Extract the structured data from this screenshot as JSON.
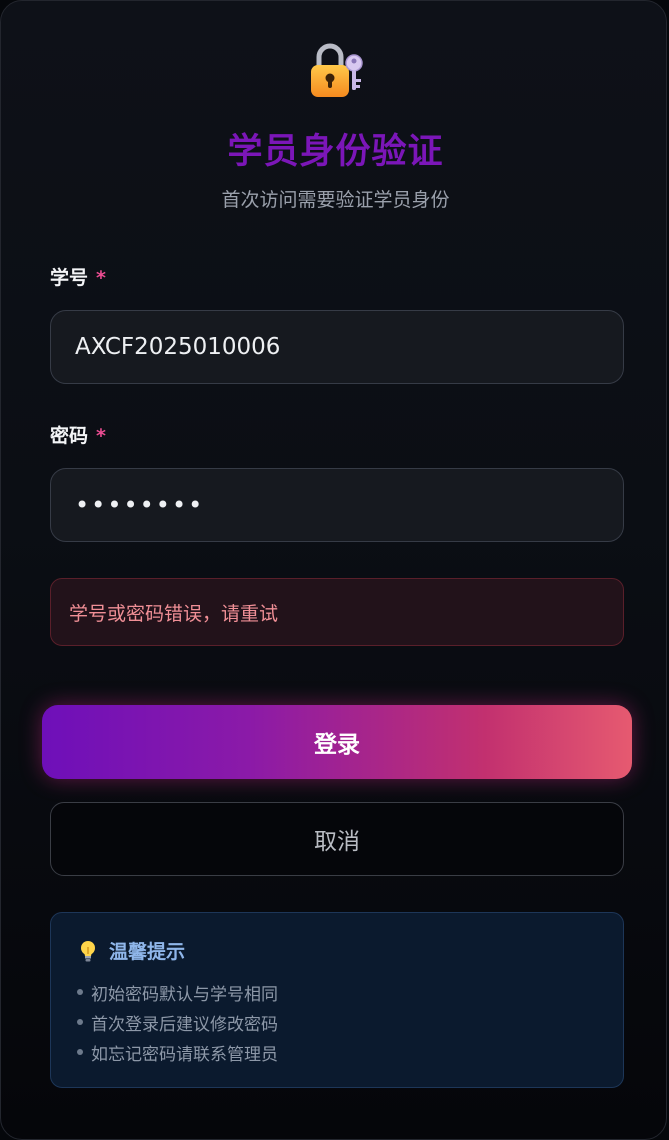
{
  "header": {
    "icon": "lock-with-key-icon",
    "title": "学员身份验证",
    "subtitle": "首次访问需要验证学员身份"
  },
  "form": {
    "student_id": {
      "label": "学号",
      "required_mark": "*",
      "value": "AXCF2025010006"
    },
    "password": {
      "label": "密码",
      "required_mark": "*",
      "value": "••••••••"
    },
    "error_message": "学号或密码错误，请重试"
  },
  "actions": {
    "login_label": "登录",
    "cancel_label": "取消"
  },
  "tips": {
    "icon": "lightbulb-icon",
    "title": "温馨提示",
    "items": [
      "初始密码默认与学号相同",
      "首次登录后建议修改密码",
      "如忘记密码请联系管理员"
    ]
  },
  "colors": {
    "title": "#7b16b8",
    "required": "#ec4d93",
    "error_text": "#f08f96",
    "button_gradient_start": "#6e0fb9",
    "button_gradient_end": "#e65a70",
    "tips_title": "#8fb6ea"
  }
}
